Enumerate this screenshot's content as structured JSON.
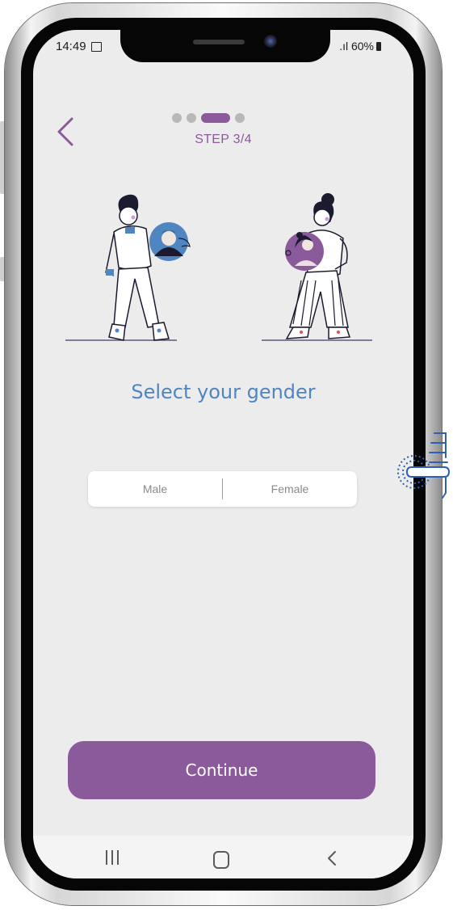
{
  "status_bar": {
    "time": "14:49",
    "right": ".ıl 60%",
    "image_icon": "image-icon",
    "battery_icon": "battery-icon"
  },
  "header": {
    "back_icon": "chevron-left-icon",
    "progress": {
      "current": 3,
      "total": 4
    },
    "step_label": "STEP 3/4"
  },
  "illustration": {
    "icon": "gender-illustration-icon"
  },
  "main": {
    "title": "Select your gender",
    "options": [
      "Male",
      "Female"
    ]
  },
  "footer": {
    "continue_label": "Continue"
  },
  "nav_bar": {
    "recent_icon": "recent-apps-icon",
    "home_icon": "home-icon",
    "back_icon": "back-icon"
  },
  "hint": {
    "icon": "tap-hand-icon"
  },
  "colors": {
    "accent": "#8b5a9b",
    "title": "#4f86c2",
    "background": "#ececed"
  }
}
